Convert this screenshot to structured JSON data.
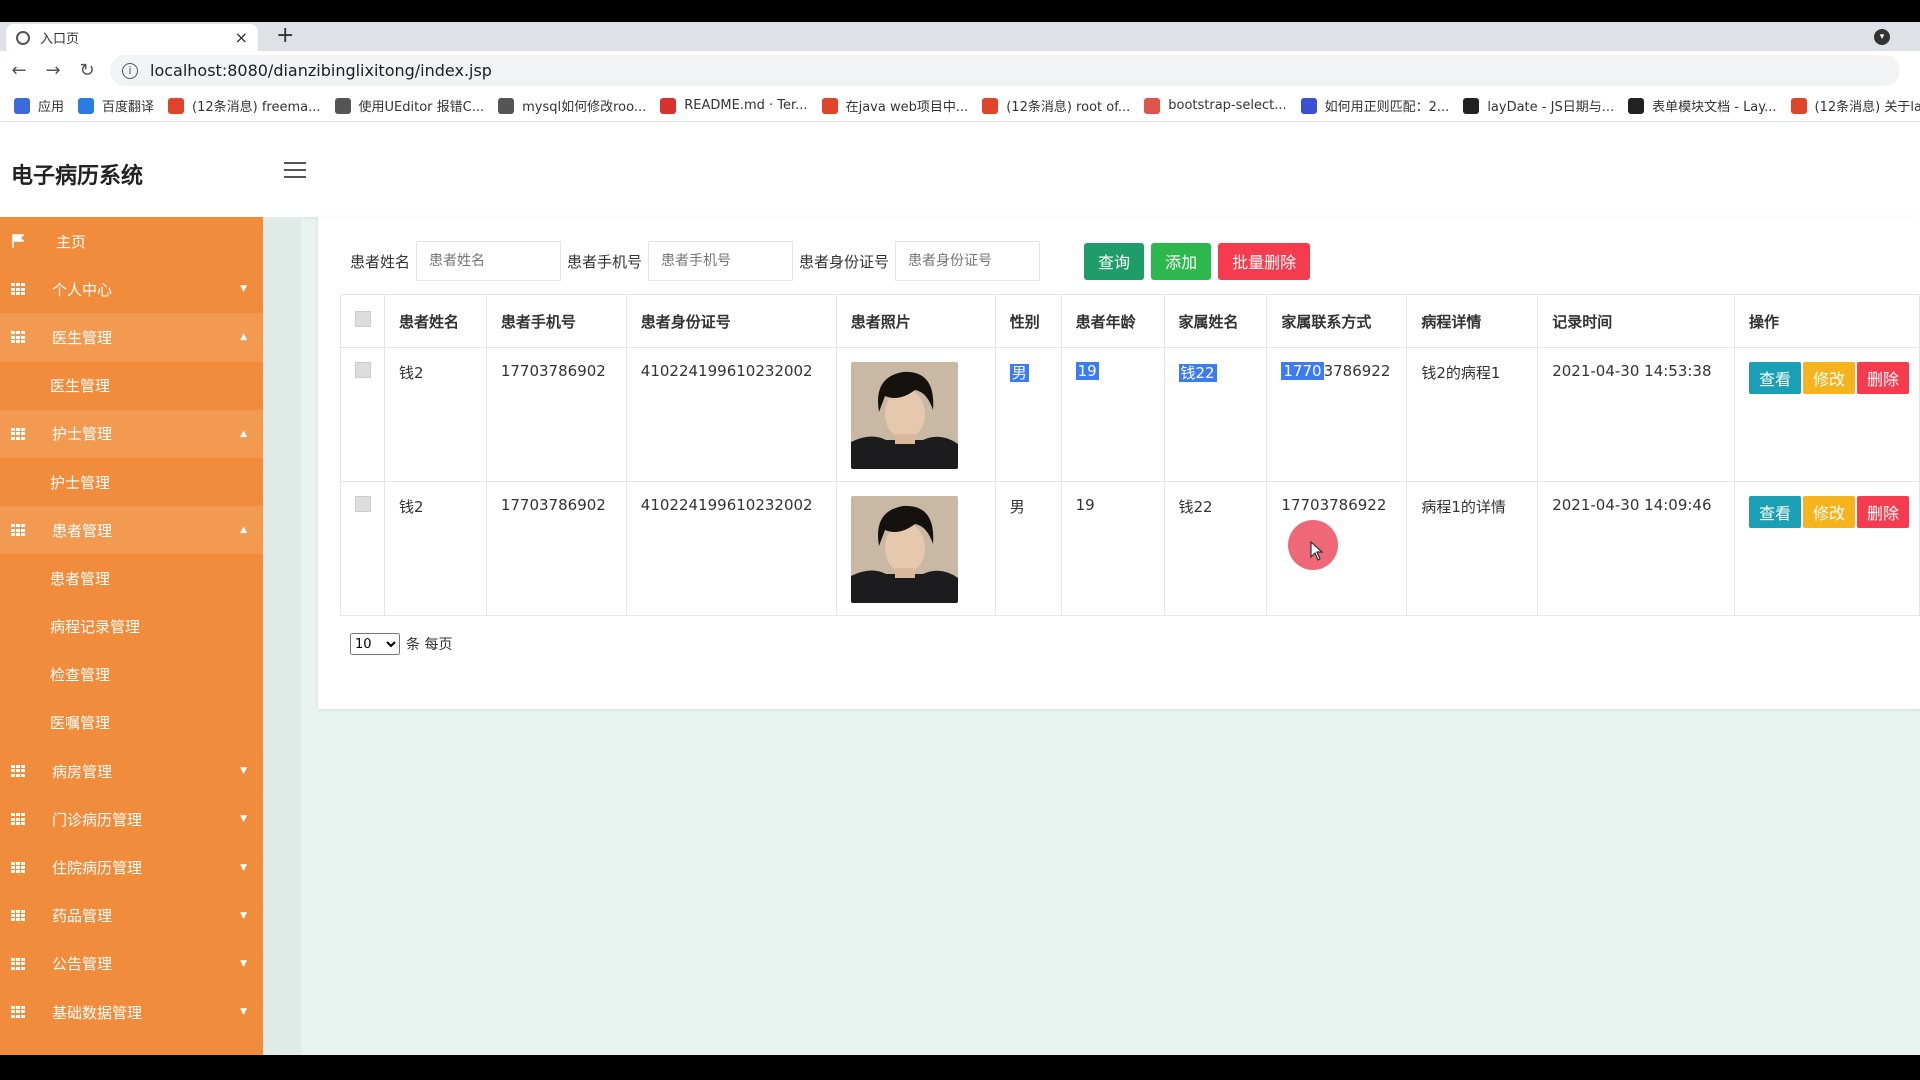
{
  "browser": {
    "tab_title": "入口页",
    "close_glyph": "×",
    "new_tab_glyph": "+",
    "url": "localhost:8080/dianzibinglixitong/index.jsp",
    "bookmarks": [
      {
        "label": "应用",
        "color": "#3c6adb",
        "icon": "apps-grid-icon"
      },
      {
        "label": "百度翻译",
        "color": "#2a7be4",
        "icon": "baidu-translate-icon"
      },
      {
        "label": "(12条消息) freema...",
        "color": "#e0452b",
        "icon": "csdn-icon"
      },
      {
        "label": "使用UEditor 报错C...",
        "color": "#555555",
        "icon": "ueditor-icon"
      },
      {
        "label": "mysql如何修改roo...",
        "color": "#555555",
        "icon": "ueditor-icon"
      },
      {
        "label": "README.md · Ter...",
        "color": "#d8322d",
        "icon": "gitee-icon"
      },
      {
        "label": "在java web项目中...",
        "color": "#e0452b",
        "icon": "csdn-icon"
      },
      {
        "label": "(12条消息) root of...",
        "color": "#e0452b",
        "icon": "csdn-icon"
      },
      {
        "label": "bootstrap-select...",
        "color": "#e0534a",
        "icon": "jianshu-icon"
      },
      {
        "label": "如何用正则匹配：2...",
        "color": "#3a4fd4",
        "icon": "baidu-paw-icon"
      },
      {
        "label": "layDate - JS日期与...",
        "color": "#222222",
        "icon": "layui-icon"
      },
      {
        "label": "表单模块文档 - Lay...",
        "color": "#222222",
        "icon": "layui-icon"
      },
      {
        "label": "(12条消息) 关于la",
        "color": "#e0452b",
        "icon": "csdn-icon"
      }
    ]
  },
  "app": {
    "brand": "电子病历系统",
    "sidebar": [
      {
        "label": "主页",
        "type": "home"
      },
      {
        "label": "个人中心",
        "type": "group",
        "caret": "▼"
      },
      {
        "label": "医生管理",
        "type": "expanded",
        "caret": "▲"
      },
      {
        "label": "医生管理",
        "type": "sub"
      },
      {
        "label": "护士管理",
        "type": "expanded",
        "caret": "▲"
      },
      {
        "label": "护士管理",
        "type": "sub"
      },
      {
        "label": "患者管理",
        "type": "expanded",
        "caret": "▲"
      },
      {
        "label": "患者管理",
        "type": "sub"
      },
      {
        "label": "病程记录管理",
        "type": "sub"
      },
      {
        "label": "检查管理",
        "type": "sub"
      },
      {
        "label": "医嘱管理",
        "type": "sub"
      },
      {
        "label": "病房管理",
        "type": "group",
        "caret": "▼"
      },
      {
        "label": "门诊病历管理",
        "type": "group",
        "caret": "▼"
      },
      {
        "label": "住院病历管理",
        "type": "group",
        "caret": "▼"
      },
      {
        "label": "药品管理",
        "type": "group",
        "caret": "▼"
      },
      {
        "label": "公告管理",
        "type": "group",
        "caret": "▼"
      },
      {
        "label": "基础数据管理",
        "type": "group",
        "caret": "▼"
      }
    ],
    "search": {
      "name_label": "患者姓名",
      "name_placeholder": "患者姓名",
      "phone_label": "患者手机号",
      "phone_placeholder": "患者手机号",
      "id_label": "患者身份证号",
      "id_placeholder": "患者身份证号",
      "query_btn": "查询",
      "add_btn": "添加",
      "batch_delete_btn": "批量删除"
    },
    "table": {
      "headers": [
        "患者姓名",
        "患者手机号",
        "患者身份证号",
        "患者照片",
        "性别",
        "患者年龄",
        "家属姓名",
        "家属联系方式",
        "病程详情",
        "记录时间",
        "操作"
      ],
      "rows": [
        {
          "name": "钱2",
          "phone": "17703786902",
          "id_card": "410224199610232002",
          "gender": "男",
          "age": "19",
          "family_name": "钱22",
          "family_phone_sel": "1770",
          "family_phone_rest": "3786922",
          "course": "钱2的病程1",
          "time": "2021-04-30 14:53:38"
        },
        {
          "name": "钱2",
          "phone": "17703786902",
          "id_card": "410224199610232002",
          "gender": "男",
          "age": "19",
          "family_name": "钱22",
          "family_phone_sel": "",
          "family_phone_rest": "17703786922",
          "course": "病程1的详情",
          "time": "2021-04-30 14:09:46"
        }
      ],
      "ops": {
        "view": "查看",
        "edit": "修改",
        "delete": "删除"
      }
    },
    "pager": {
      "page_size": "10",
      "per_page_text": "条 每页"
    }
  }
}
